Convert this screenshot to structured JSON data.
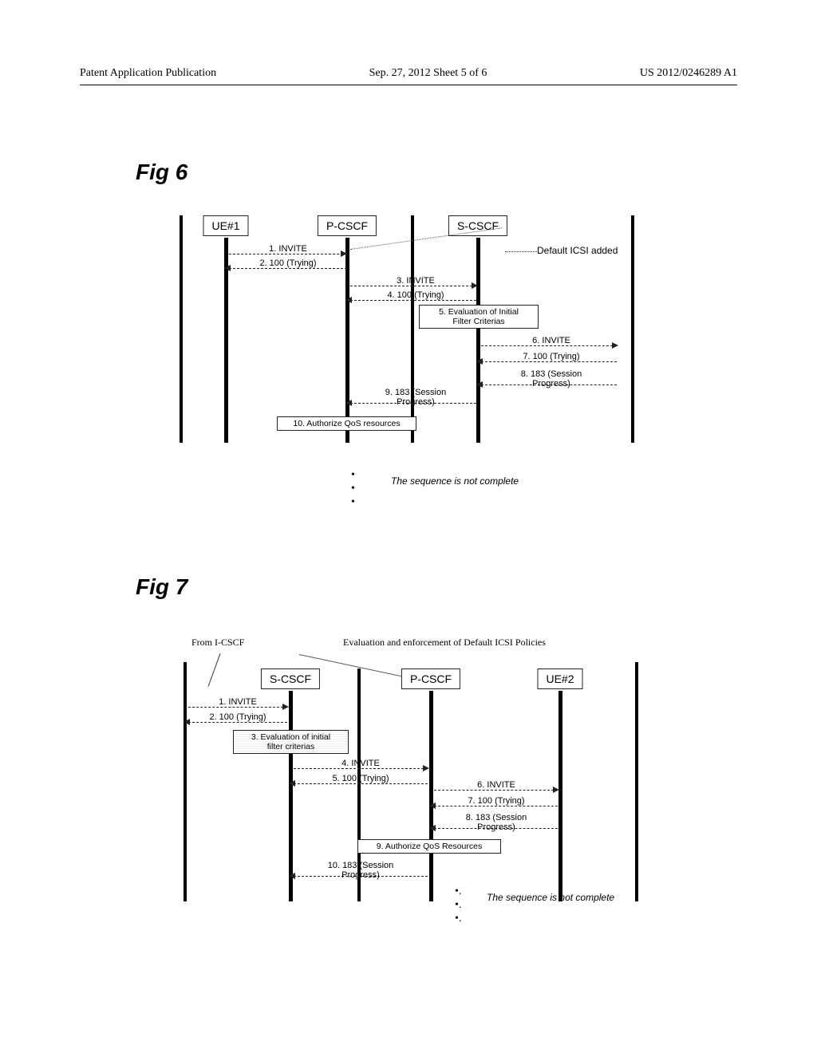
{
  "header": {
    "left": "Patent Application Publication",
    "center": "Sep. 27, 2012  Sheet 5 of 6",
    "right": "US 2012/0246289 A1"
  },
  "fig6": {
    "label": "Fig 6",
    "actors": {
      "a1": "UE#1",
      "a2": "P-CSCF",
      "a3": "S-CSCF"
    },
    "side_note": "Default ICSI added",
    "messages": {
      "m1": "1. INVITE",
      "m2": "2. 100 (Trying)",
      "m3": "3. INVITE",
      "m4": "4. 100 (Trying)",
      "m5": "5. Evaluation of Initial\nFilter Criterias",
      "m6": "6. INVITE",
      "m7": "7. 100 (Trying)",
      "m8": "8. 183 (Session\nProgress)",
      "m9": "9. 183 (Session\nProgress)",
      "m10": "10. Authorize QoS resources"
    },
    "incomplete": "The sequence is not complete"
  },
  "fig7": {
    "label": "Fig 7",
    "top_left_note": "From I-CSCF",
    "top_right_note": "Evaluation and enforcement of Default ICSI Policies",
    "actors": {
      "a1": "S-CSCF",
      "a2": "P-CSCF",
      "a3": "UE#2"
    },
    "messages": {
      "m1": "1. INVITE",
      "m2": "2. 100 (Trying)",
      "m3": "3. Evaluation of initial\nfilter criterias",
      "m4": "4. INVITE",
      "m5": "5. 100 (Trying)",
      "m6": "6. INVITE",
      "m7": "7. 100 (Trying)",
      "m8": "8. 183 (Session\nProgress)",
      "m9": "9. Authorize QoS Resources",
      "m10": "10. 183 (Session\nProgress)"
    },
    "incomplete": "The sequence is not complete"
  }
}
